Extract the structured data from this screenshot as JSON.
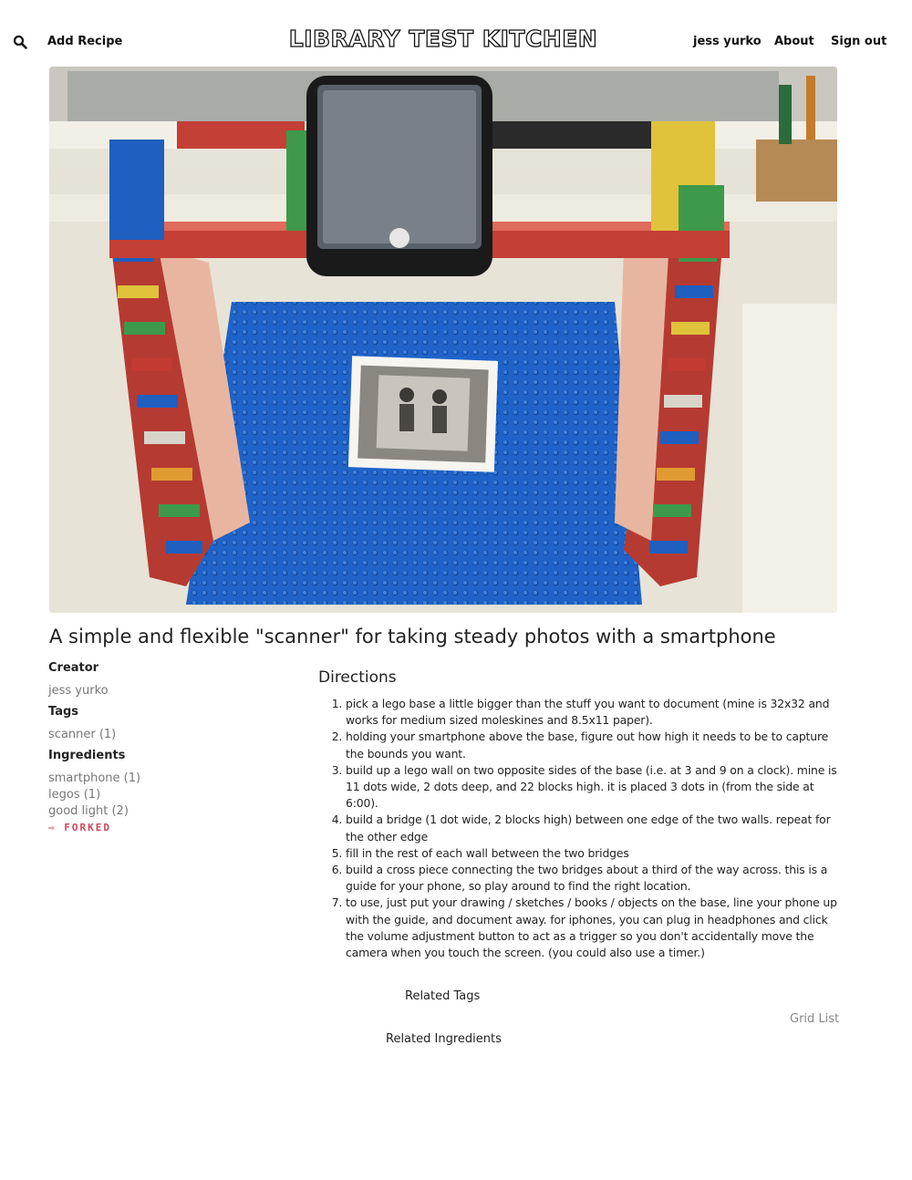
{
  "header": {
    "add_recipe": "Add Recipe",
    "logo": "LIBRARY TEST KITCHEN",
    "nav": {
      "user": "jess yurko",
      "about": "About",
      "sign_out": "Sign out"
    },
    "search_icon": "search-icon"
  },
  "recipe": {
    "title": "A simple and flexible \"scanner\" for taking steady photos with a smartphone",
    "creator_heading": "Creator",
    "creator": "jess yurko",
    "tags_heading": "Tags",
    "tags": [
      "scanner (1)"
    ],
    "ingredients_heading": "Ingredients",
    "ingredients": [
      "smartphone (1)",
      "legos (1)",
      "good light (2)"
    ],
    "forked_label": "⇨ FORKED",
    "directions_heading": "Directions",
    "directions": [
      "pick a lego base a little bigger than the stuff you want to document (mine is 32x32 and works for medium sized moleskines and 8.5x11 paper).",
      "holding your smartphone above the base, figure out how high it needs to be to capture the bounds you want.",
      "build up a lego wall on two opposite sides of the base (i.e. at 3 and 9 on a clock). mine is 11 dots wide, 2 dots deep, and 22 blocks high. it is placed 3 dots in (from the side at 6:00).",
      "build a bridge (1 dot wide, 2 blocks high) between one edge of the two walls. repeat for the other edge",
      "fill in the rest of each wall between the two bridges",
      "build a cross piece connecting the two bridges about a third of the way across. this is a guide for your phone, so play around to find the right location.",
      "to use, just put your drawing / sketches / books / objects on the base, line your phone up with the guide, and document away. for iphones, you can plug in headphones and click the volume adjustment button to act as a trigger so you don't accidentally move the camera when you touch the screen. (you could also use a timer.)"
    ]
  },
  "related": {
    "tags_label": "Related Tags",
    "grid_list": "Grid List",
    "ingredients_label": "Related Ingredients"
  }
}
